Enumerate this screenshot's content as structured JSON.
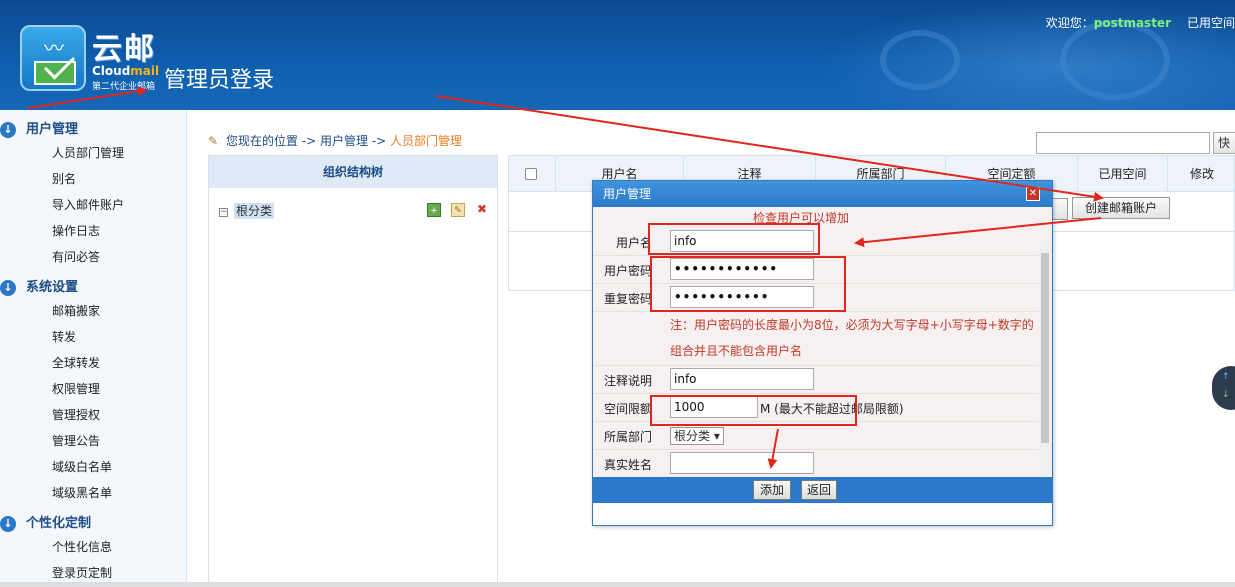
{
  "header": {
    "brand_cn": "云邮",
    "brand_en_prefix": "Cloud",
    "brand_en_suffix": "mail",
    "brand_sub": "第二代企业邮箱",
    "admin_title": "管理员登录",
    "welcome_prefix": "欢迎您：",
    "username": "postmaster",
    "used_space": "已用空间"
  },
  "sidebar": {
    "sections": [
      {
        "title": "用户管理",
        "items": [
          "人员部门管理",
          "别名",
          "导入邮件账户",
          "操作日志",
          "有问必答"
        ]
      },
      {
        "title": "系统设置",
        "items": [
          "邮箱搬家",
          "转发",
          "全球转发",
          "权限管理",
          "管理授权",
          "管理公告",
          "域级白名单",
          "域级黑名单"
        ]
      },
      {
        "title": "个性化定制",
        "items": [
          "个性化信息",
          "登录页定制"
        ]
      }
    ]
  },
  "breadcrumb": {
    "prefix": "您现在的位置 -> ",
    "level1": "用户管理",
    "sep": " -> ",
    "current": "人员部门管理"
  },
  "search": {
    "value": "",
    "button_label": "快"
  },
  "tree": {
    "header": "组织结构树",
    "root_label": "根分类"
  },
  "table": {
    "columns": [
      "用户名",
      "注释",
      "所属部门",
      "空间定额",
      "已用空间",
      "修改"
    ],
    "create_button": "创建邮箱账户"
  },
  "dialog": {
    "title": "用户管理",
    "check_message": "检查用户可以增加",
    "fields": {
      "username_label": "用户名",
      "username_value": "info",
      "password_label": "用户密码",
      "password_value": "••••••••••••",
      "repeat_label": "重复密码",
      "repeat_value": "•••••••••••",
      "note_line1": "注：用户密码的长度最小为8位，必须为大写字母+小写字母+数字的",
      "note_line2": "组合并且不能包含用户名",
      "comment_label": "注释说明",
      "comment_value": "info",
      "quota_label": "空间限额",
      "quota_value": "1000",
      "quota_unit": "M (最大不能超过邮局限额)",
      "dept_label": "所属部门",
      "dept_value": "根分类",
      "realname_label": "真实姓名",
      "realname_value": ""
    },
    "add_button": "添加",
    "back_button": "返回"
  },
  "colors": {
    "header_blue": "#0f5faf",
    "annotation_red": "#e1261c",
    "dialog_blue": "#2b7ac9",
    "warning_red": "#c0392b",
    "breadcrumb_current": "#e67e22"
  }
}
